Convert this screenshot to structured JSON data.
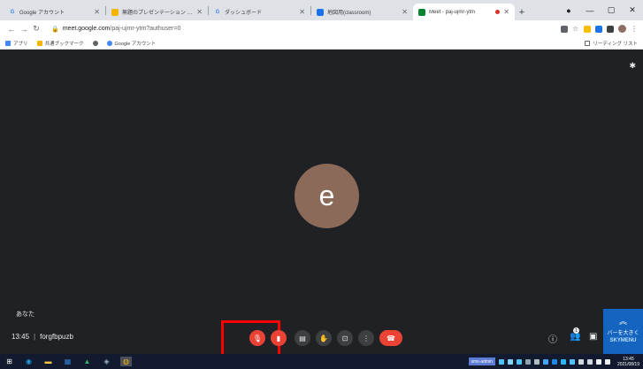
{
  "browser": {
    "tabs": [
      {
        "title": "Google アカウント",
        "favicon": "G",
        "favicon_color": "#4285f4",
        "active": false
      },
      {
        "title": "無題のプレゼンテーション - Google ...",
        "favicon": "",
        "favicon_color": "#f4b400",
        "active": false
      },
      {
        "title": "ダッシュボード",
        "favicon": "G",
        "favicon_color": "#4285f4",
        "active": false
      },
      {
        "title": "地図用(classroom)",
        "favicon": "",
        "favicon_color": "#1a73e8",
        "active": false
      },
      {
        "title": "Meet - paj-ujmr-ytm",
        "favicon": "",
        "favicon_color": "#00832d",
        "active": true
      }
    ],
    "url_host": "meet.google.com",
    "url_path": "/paj-ujmr-ytm?authuser=0",
    "bookmarks": [
      {
        "label": "アプリ",
        "color": "#4285f4"
      },
      {
        "label": "共通ブックマーク",
        "color": "#f4b400"
      },
      {
        "label": "",
        "color": "#5f6368"
      },
      {
        "label": "Google アカウント",
        "color": "#4285f4"
      }
    ],
    "reading_list": "リーディング リスト"
  },
  "meet": {
    "avatar_letter": "e",
    "avatar_color": "#8b6a5a",
    "self_label": "あなた",
    "time": "13:45",
    "meeting_code": "forgfbpuzb",
    "participant_count": "1",
    "promo": {
      "text": "バーを大きく",
      "brand": "SKYMENU"
    }
  },
  "taskbar": {
    "user_tag": "sms-admin",
    "clock_time": "13:45",
    "clock_date": "2021/08/19"
  }
}
